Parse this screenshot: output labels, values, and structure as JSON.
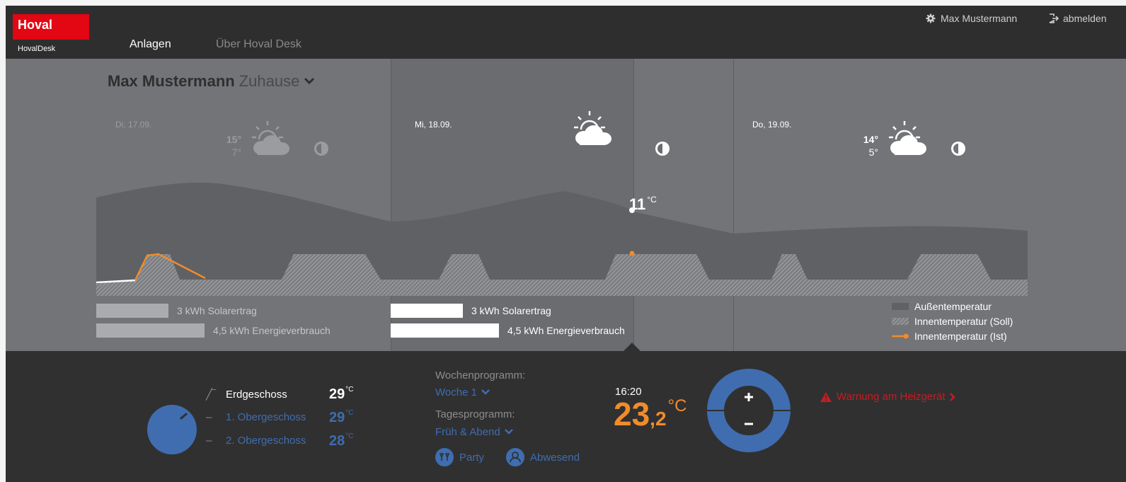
{
  "brand": {
    "logo_text": "Hoval",
    "product_name": "HovalDesk"
  },
  "nav": {
    "anlagen": "Anlagen",
    "about": "Über Hoval Desk"
  },
  "user": {
    "name": "Max Mustermann",
    "logout_label": "abmelden"
  },
  "home": {
    "owner": "Max Mustermann",
    "location": "Zuhause"
  },
  "days": [
    {
      "date": "Di, 17.09.",
      "tmax": "15°",
      "tmin": "7°",
      "weather_icon": "partly-cloudy-icon",
      "moon_icon": "half-moon-icon"
    },
    {
      "date": "Mi, 18.09.",
      "tmax": "",
      "tmin": "",
      "weather_icon": "partly-cloudy-icon",
      "moon_icon": "half-moon-icon"
    },
    {
      "date": "Do, 19.09.",
      "tmax": "14°",
      "tmin": "5°",
      "weather_icon": "partly-cloudy-icon",
      "moon_icon": "half-moon-icon"
    }
  ],
  "current_outdoor": {
    "value": "11",
    "unit": "°C"
  },
  "energy": [
    {
      "solar_label": "3 kWh Solarertrag",
      "consumption_label": "4,5 kWh Energieverbrauch",
      "solar_kwh": 3,
      "consumption_kwh": 4.5
    },
    {
      "solar_label": "3 kWh Solarertrag",
      "consumption_label": "4,5 kWh Energieverbrauch",
      "solar_kwh": 3,
      "consumption_kwh": 4.5
    }
  ],
  "legend": {
    "outdoor": "Außentemperatur",
    "indoor_target": "Innentemperatur (Soll)",
    "indoor_actual": "Innentemperatur (Ist)"
  },
  "zones": [
    {
      "name": "Erdgeschoss",
      "value": "29",
      "unit": "°C",
      "selected": true
    },
    {
      "name": "1. Obergeschoss",
      "value": "29",
      "unit": "°C",
      "selected": false
    },
    {
      "name": "2. Obergeschoss",
      "value": "28",
      "unit": "°C",
      "selected": false
    }
  ],
  "program": {
    "weekly_label": "Wochenprogramm:",
    "weekly_value": "Woche 1",
    "daily_label": "Tagesprogramm:",
    "daily_value": "Früh & Abend"
  },
  "modes": {
    "party": "Party",
    "away": "Abwesend"
  },
  "room": {
    "time": "16:20",
    "temp_int": "23",
    "temp_dec": ",2",
    "unit": "°C"
  },
  "warning": {
    "text": "Warnung am Heizgerät",
    "icon": "warning-triangle-icon"
  },
  "colors": {
    "brand_red": "#e30613",
    "accent_orange": "#f08c2c",
    "accent_blue": "#3f6db0",
    "warning_red": "#c41d22"
  },
  "chart_data": {
    "type": "area",
    "series": [
      {
        "name": "Außentemperatur"
      },
      {
        "name": "Innentemperatur (Soll)"
      },
      {
        "name": "Innentemperatur (Ist)"
      }
    ]
  }
}
